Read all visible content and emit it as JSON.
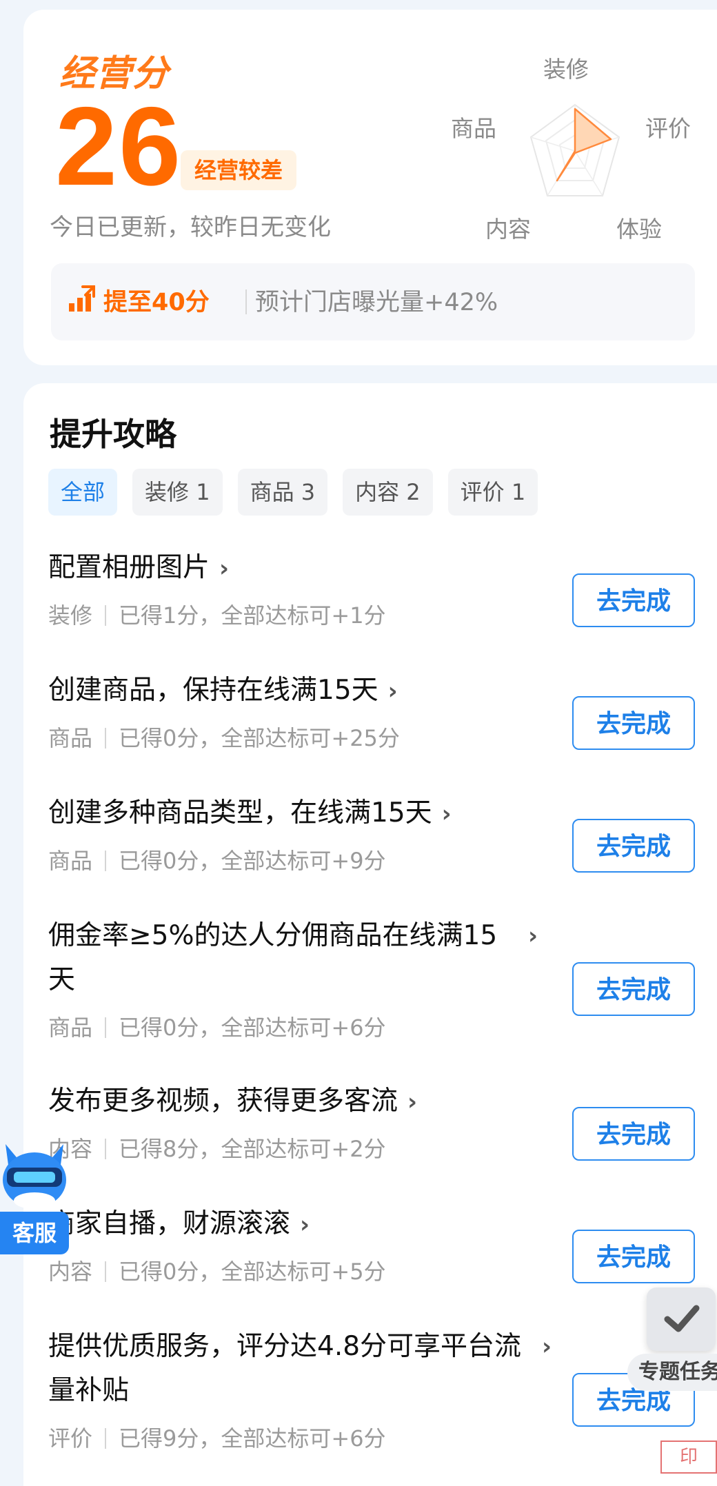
{
  "score_card": {
    "logo": "经营分",
    "score": "26",
    "badge": "经营较差",
    "update_text": "今日已更新，较昨日无变化",
    "radar_labels": {
      "top": "装修",
      "right": "评价",
      "bottom_right": "体验",
      "bottom_left": "内容",
      "left": "商品"
    },
    "tip_strong": "提至40分",
    "tip_text": "预计门店曝光量+42%",
    "accent_color": "#ff6a00"
  },
  "strategy": {
    "title": "提升攻略",
    "filters": [
      "全部",
      "装修 1",
      "商品 3",
      "内容 2",
      "评价 1"
    ],
    "button_label": "去完成",
    "tasks": [
      {
        "title": "配置相册图片",
        "category": "装修",
        "detail": "已得1分，全部达标可+1分"
      },
      {
        "title": "创建商品，保持在线满15天",
        "category": "商品",
        "detail": "已得0分，全部达标可+25分"
      },
      {
        "title": "创建多种商品类型，在线满15天",
        "category": "商品",
        "detail": "已得0分，全部达标可+9分"
      },
      {
        "title": "佣金率≥5%的达人分佣商品在线满15天",
        "category": "商品",
        "detail": "已得0分，全部达标可+6分"
      },
      {
        "title": "发布更多视频，获得更多客流",
        "category": "内容",
        "detail": "已得8分，全部达标可+2分"
      },
      {
        "title": "商家自播，财源滚滚",
        "category": "内容",
        "detail": "已得0分，全部达标可+5分"
      },
      {
        "title": "提供优质服务，评分达4.8分可享平台流量补贴",
        "category": "评价",
        "detail": "已得9分，全部达标可+6分"
      }
    ],
    "accent_color": "#1e80e8"
  },
  "floating": {
    "customer_service": "客服",
    "topic_task": "专题任务"
  }
}
